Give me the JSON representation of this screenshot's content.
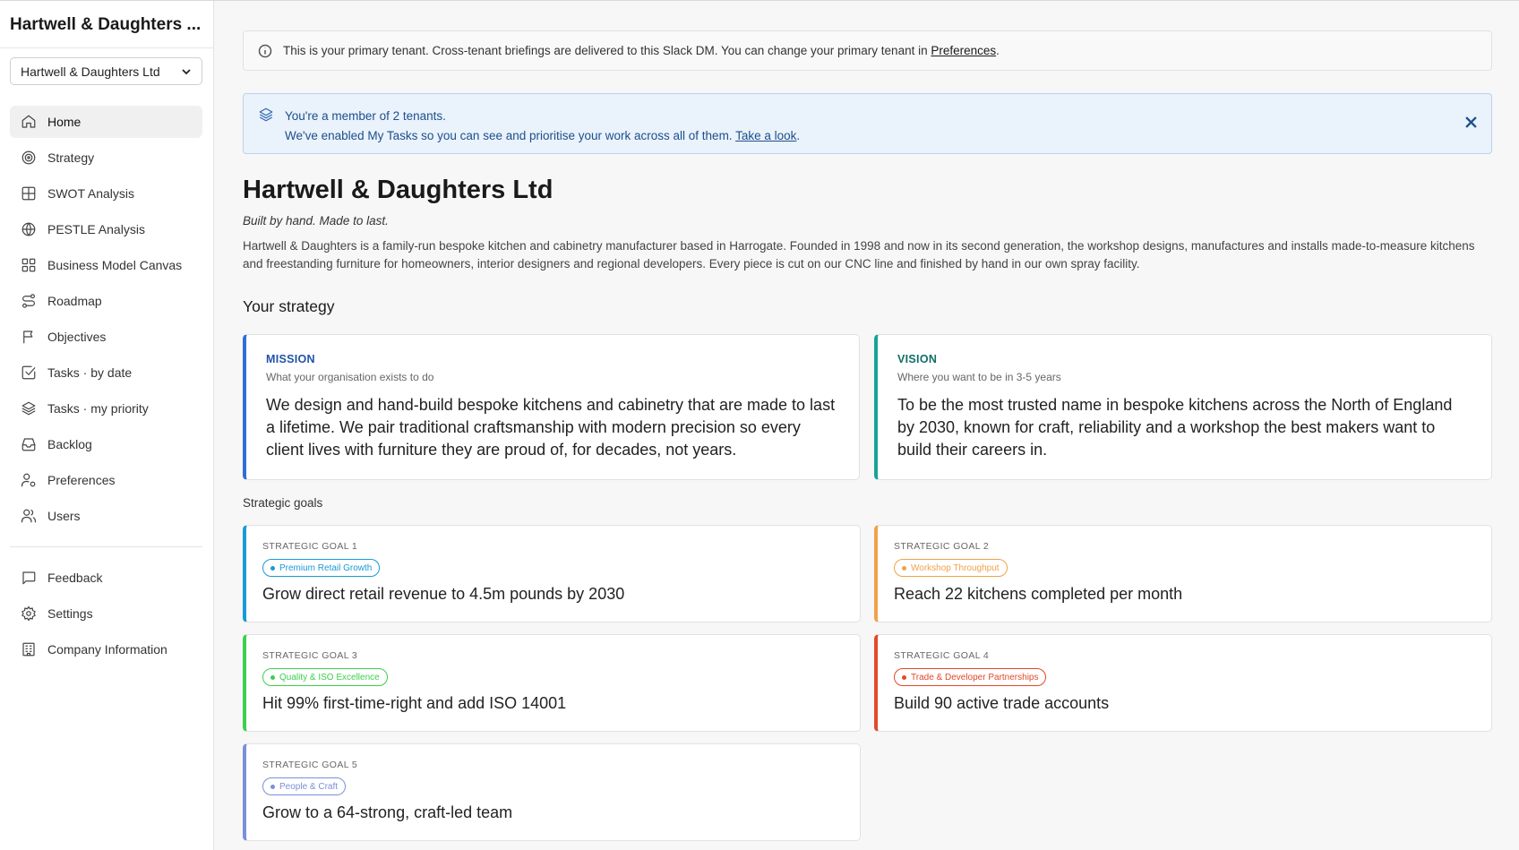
{
  "sidebar": {
    "title": "Hartwell & Daughters ...",
    "tenant_select": "Hartwell & Daughters Ltd",
    "items": [
      {
        "label": "Home",
        "icon": "home-icon",
        "active": true
      },
      {
        "label": "Strategy",
        "icon": "target-icon"
      },
      {
        "label": "SWOT Analysis",
        "icon": "grid-icon"
      },
      {
        "label": "PESTLE Analysis",
        "icon": "globe-icon"
      },
      {
        "label": "Business Model Canvas",
        "icon": "layout-grid-icon"
      },
      {
        "label": "Roadmap",
        "icon": "route-icon"
      },
      {
        "label": "Objectives",
        "icon": "flag-icon"
      },
      {
        "label": "Tasks · by date",
        "icon": "check-square-icon"
      },
      {
        "label": "Tasks · my priority",
        "icon": "layers-icon"
      },
      {
        "label": "Backlog",
        "icon": "inbox-icon"
      }
    ],
    "items2": [
      {
        "label": "Preferences",
        "icon": "user-cog-icon"
      },
      {
        "label": "Users",
        "icon": "users-icon"
      }
    ],
    "items3": [
      {
        "label": "Feedback",
        "icon": "message-square-icon"
      },
      {
        "label": "Settings",
        "icon": "gear-icon"
      },
      {
        "label": "Company Information",
        "icon": "building-icon"
      }
    ]
  },
  "info_bar": {
    "text": "This is your primary tenant. Cross-tenant briefings are delivered to this Slack DM. You can change your primary tenant in ",
    "link": "Preferences",
    "end": "."
  },
  "tenant_banner": {
    "line1": "You're a member of 2 tenants.",
    "line2": "We've enabled My Tasks so you can see and prioritise your work across all of them. ",
    "link": "Take a look",
    "end": "."
  },
  "company": {
    "name": "Hartwell & Daughters Ltd",
    "tagline": "Built by hand. Made to last.",
    "description": "Hartwell & Daughters is a family-run bespoke kitchen and cabinetry manufacturer based in Harrogate. Founded in 1998 and now in its second generation, the workshop designs, manufactures and installs made-to-measure kitchens and freestanding furniture for homeowners, interior designers and regional developers. Every piece is cut on our CNC line and finished by hand in our own spray facility."
  },
  "strategy": {
    "heading": "Your strategy",
    "mission": {
      "label": "MISSION",
      "sub": "What your organisation exists to do",
      "text": "We design and hand-build bespoke kitchens and cabinetry that are made to last a lifetime. We pair traditional craftsmanship with modern precision so every client lives with furniture they are proud of, for decades, not years."
    },
    "vision": {
      "label": "VISION",
      "sub": "Where you want to be in 3-5 years",
      "text": "To be the most trusted name in bespoke kitchens across the North of England by 2030, known for craft, reliability and a workshop the best makers want to build their careers in."
    },
    "goals_heading": "Strategic goals",
    "goals": [
      {
        "label": "STRATEGIC GOAL 1",
        "tag": "Premium Retail Growth",
        "title": "Grow direct retail revenue to 4.5m pounds by 2030",
        "color": "#1a9ad6"
      },
      {
        "label": "STRATEGIC GOAL 2",
        "tag": "Workshop Throughput",
        "title": "Reach 22 kitchens completed per month",
        "color": "#f0a24a"
      },
      {
        "label": "STRATEGIC GOAL 3",
        "tag": "Quality & ISO Excellence",
        "title": "Hit 99% first-time-right and add ISO 14001",
        "color": "#3ccf4e"
      },
      {
        "label": "STRATEGIC GOAL 4",
        "tag": "Trade & Developer Partnerships",
        "title": "Build 90 active trade accounts",
        "color": "#e04a2a"
      },
      {
        "label": "STRATEGIC GOAL 5",
        "tag": "People & Craft",
        "title": "Grow to a 64-strong, craft-led team",
        "color": "#7b8fd9"
      }
    ]
  }
}
